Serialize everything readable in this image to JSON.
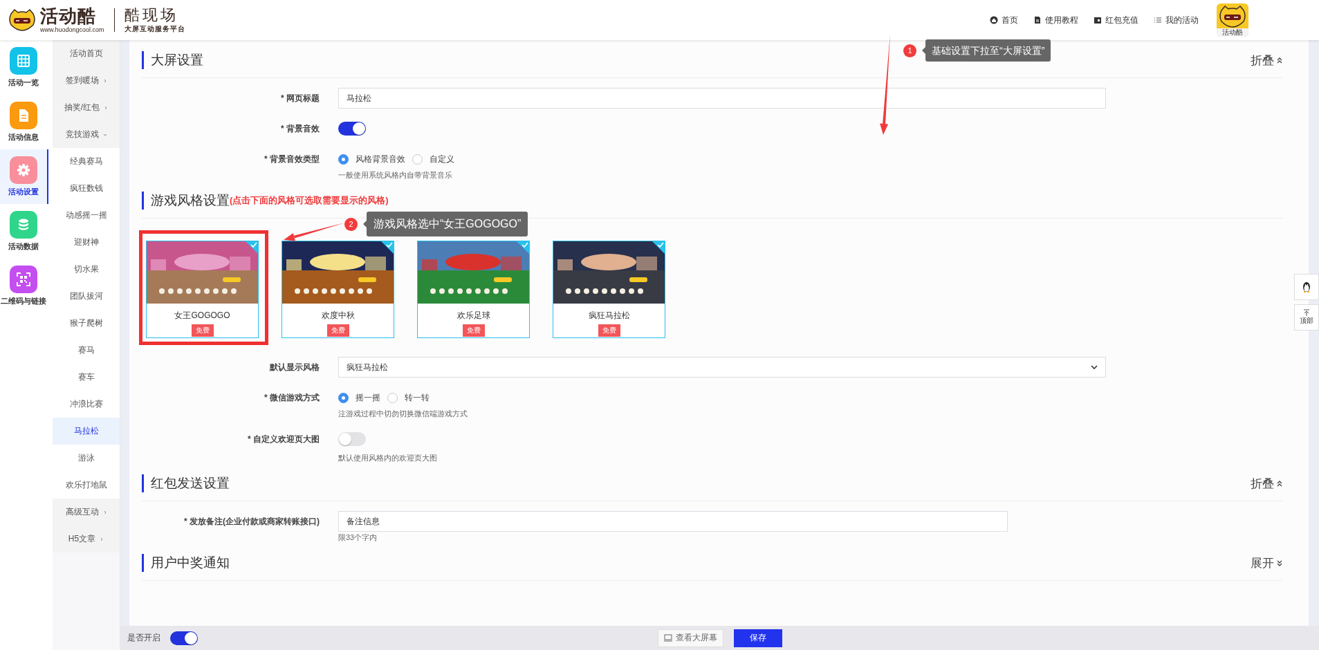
{
  "header": {
    "brand": "活动酷",
    "url": "www.huodongcool.com",
    "product": "酷现场",
    "tagline": "大屏互动服务平台",
    "nav": [
      {
        "label": "首页"
      },
      {
        "label": "使用教程"
      },
      {
        "label": "红包充值"
      },
      {
        "label": "我的活动"
      }
    ],
    "avatar_label": "活动酷"
  },
  "rail": [
    {
      "label": "活动一览",
      "color": "#13c2e8",
      "selected": false
    },
    {
      "label": "活动信息",
      "color": "#fa9a0e",
      "selected": false
    },
    {
      "label": "活动设置",
      "color": "#f98f9b",
      "selected": true
    },
    {
      "label": "活动数据",
      "color": "#2fd58a",
      "selected": false
    },
    {
      "label": "二维码与链接",
      "color": "#c44ef0",
      "selected": false
    }
  ],
  "submenu": [
    {
      "label": "活动首页",
      "selected": false
    },
    {
      "label": "签到暖场",
      "expanded": false,
      "selected": false
    },
    {
      "label": "抽奖/红包",
      "expanded": false,
      "selected": false
    },
    {
      "label": "竞技游戏",
      "expanded": true,
      "selected": false,
      "children": [
        {
          "label": "经典赛马",
          "selected": false
        },
        {
          "label": "疯狂数钱",
          "selected": false
        },
        {
          "label": "动感摇一摇",
          "selected": false
        },
        {
          "label": "迎财神",
          "selected": false
        },
        {
          "label": "切水果",
          "selected": false
        },
        {
          "label": "团队拔河",
          "selected": false
        },
        {
          "label": "猴子爬树",
          "selected": false
        },
        {
          "label": "赛马",
          "selected": false
        },
        {
          "label": "赛车",
          "selected": false
        },
        {
          "label": "冲浪比赛",
          "selected": false
        },
        {
          "label": "马拉松",
          "selected": true
        },
        {
          "label": "游泳",
          "selected": false
        },
        {
          "label": "欢乐打地鼠",
          "selected": false
        }
      ]
    },
    {
      "label": "高级互动",
      "expanded": false,
      "selected": false
    },
    {
      "label": "H5文章",
      "expanded": false,
      "selected": false
    }
  ],
  "sections": [
    {
      "title": "大屏设置",
      "toggle": "折叠",
      "expanded": true,
      "fields": [
        {
          "kind": "input",
          "label": "* 网页标题",
          "value": "马拉松"
        },
        {
          "kind": "switch",
          "label": "* 背景音效",
          "on": true
        },
        {
          "kind": "radio",
          "label": "* 背景音效类型",
          "options": [
            {
              "label": "风格背景音效",
              "selected": true
            },
            {
              "label": "自定义",
              "selected": false
            }
          ],
          "hint": "一般使用系统风格内自带背景音乐"
        }
      ]
    },
    {
      "title": "游戏风格设置",
      "subtitle": "(点击下面的风格可选取需要显示的风格)",
      "styles": [
        {
          "name": "女王GOGOGO",
          "badge": "免费",
          "checked": true,
          "highlighted": true
        },
        {
          "name": "欢度中秋",
          "badge": "免费",
          "checked": true,
          "highlighted": false
        },
        {
          "name": "欢乐足球",
          "badge": "免费",
          "checked": true,
          "highlighted": false
        },
        {
          "name": "疯狂马拉松",
          "badge": "免费",
          "checked": true,
          "highlighted": false
        }
      ],
      "fields": [
        {
          "kind": "select",
          "label": "默认显示风格",
          "value": "疯狂马拉松"
        },
        {
          "kind": "radio",
          "label": "* 微信游戏方式",
          "options": [
            {
              "label": "摇一摇",
              "selected": true
            },
            {
              "label": "转一转",
              "selected": false
            }
          ],
          "hint": "注游戏过程中切勿切换微信端游戏方式"
        },
        {
          "kind": "switch",
          "label": "* 自定义欢迎页大图",
          "on": false,
          "hint": "默认使用风格内的欢迎页大图"
        }
      ]
    },
    {
      "title": "红包发送设置",
      "toggle": "折叠",
      "expanded": true,
      "fields": [
        {
          "kind": "input",
          "label": "* 发放备注(企业付款或商家转账接口)",
          "value": "备注信息",
          "hint": "限33个字内"
        }
      ]
    },
    {
      "title": "用户中奖通知",
      "toggle": "展开",
      "expanded": false
    }
  ],
  "bottom_bar": {
    "label": "是否开启",
    "on": true,
    "buttons": [
      {
        "label": "查看大屏幕",
        "kind": "secondary"
      },
      {
        "label": "保存",
        "kind": "primary"
      }
    ]
  },
  "float_buttons": [
    {
      "kind": "qq"
    },
    {
      "kind": "top",
      "label": "顶部"
    }
  ],
  "annotations": [
    {
      "number": "1",
      "text": "基础设置下拉至“大屏设置”"
    },
    {
      "number": "2",
      "text": "游戏风格选中“女王GOGOGO”"
    }
  ]
}
